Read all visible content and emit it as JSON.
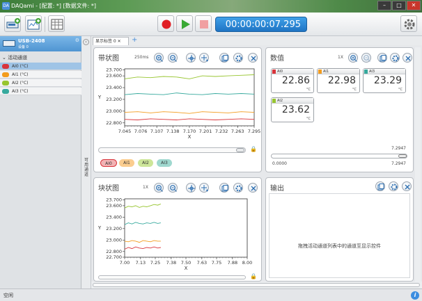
{
  "window": {
    "title": "DAQami - [配置: *] [数据文件: *]",
    "minimize": "–",
    "maximize": "□",
    "close": "✕"
  },
  "toolbar": {
    "timer": "00:00:00:07.295"
  },
  "sidebar": {
    "device_name": "USB-2408",
    "device_sub": "设备 0",
    "group_label": "活动通道",
    "channels": [
      {
        "label": "AI0 (°C)",
        "color": "#d9343b"
      },
      {
        "label": "AI1 (°C)",
        "color": "#f39c1d"
      },
      {
        "label": "AI2 (°C)",
        "color": "#97c52f"
      },
      {
        "label": "AI3 (°C)",
        "color": "#36a99d"
      }
    ],
    "collapsed_tab": "可用通道"
  },
  "tabs": {
    "active": "显示标签 0",
    "close": "✕",
    "add": "+"
  },
  "strip_chart": {
    "title": "带状图",
    "rate": "250ms",
    "pills": [
      "AI0",
      "AI1",
      "AI2",
      "AI3"
    ],
    "xlabel": "X",
    "ylabel": "Y",
    "yticks": [
      "23.700",
      "23.600",
      "23.400",
      "23.200",
      "23.000",
      "22.800"
    ],
    "xticks": [
      "7.045",
      "7.076",
      "7.107",
      "7.138",
      "7.170",
      "7.201",
      "7.232",
      "7.263",
      "7.295"
    ]
  },
  "block_chart": {
    "title": "块状图",
    "rate": "1X",
    "xlabel": "X",
    "ylabel": "Y",
    "yticks": [
      "23.700",
      "23.600",
      "23.400",
      "23.200",
      "23.000",
      "22.800",
      "22.700"
    ],
    "xticks": [
      "7.00",
      "7.13",
      "7.25",
      "7.38",
      "7.50",
      "7.63",
      "7.75",
      "7.88",
      "8.00"
    ]
  },
  "numeric_panel": {
    "title": "数值",
    "rate": "1X",
    "cards": [
      {
        "name": "AI0",
        "value": "22.86",
        "unit": "°C",
        "color": "#d9343b"
      },
      {
        "name": "AI1",
        "value": "22.98",
        "unit": "°C",
        "color": "#f39c1d"
      },
      {
        "name": "AI3",
        "value": "23.29",
        "unit": "°C",
        "color": "#36a99d"
      },
      {
        "name": "AI2",
        "value": "23.62",
        "unit": "°C",
        "color": "#97c52f"
      }
    ],
    "slider_top": "7.2947",
    "slider_min": "0.0000",
    "slider_max": "7.2947"
  },
  "output_panel": {
    "title": "输出",
    "hint": "拖拽活动通道列表中的通道至显示控件"
  },
  "status": {
    "text": "空闲",
    "info": "i"
  },
  "chart_data": [
    {
      "type": "line",
      "title": "带状图",
      "xlabel": "X",
      "ylabel": "Y",
      "ylim": [
        22.75,
        23.72
      ],
      "xlim": [
        7.045,
        7.295
      ],
      "grid": false,
      "x": [
        7.045,
        7.07,
        7.095,
        7.12,
        7.145,
        7.17,
        7.195,
        7.22,
        7.245,
        7.27,
        7.295
      ],
      "series": [
        {
          "name": "AI0",
          "color": "#d9343b",
          "values": [
            22.86,
            22.85,
            22.87,
            22.86,
            22.85,
            22.87,
            22.86,
            22.85,
            22.86,
            22.87,
            22.86
          ]
        },
        {
          "name": "AI1",
          "color": "#f39c1d",
          "values": [
            22.98,
            22.99,
            22.97,
            22.99,
            22.98,
            22.96,
            22.99,
            22.98,
            22.97,
            22.99,
            22.98
          ]
        },
        {
          "name": "AI2",
          "color": "#97c52f",
          "values": [
            23.55,
            23.58,
            23.57,
            23.59,
            23.58,
            23.55,
            23.6,
            23.59,
            23.6,
            23.61,
            23.62
          ]
        },
        {
          "name": "AI3",
          "color": "#36a99d",
          "values": [
            23.28,
            23.3,
            23.29,
            23.28,
            23.31,
            23.29,
            23.28,
            23.3,
            23.29,
            23.3,
            23.29
          ]
        }
      ]
    },
    {
      "type": "line",
      "title": "块状图",
      "xlabel": "X",
      "ylabel": "Y",
      "ylim": [
        22.7,
        23.72
      ],
      "xlim": [
        7.0,
        8.0
      ],
      "grid": false,
      "x": [
        7.0,
        7.03,
        7.06,
        7.09,
        7.12,
        7.15,
        7.18,
        7.21,
        7.24,
        7.27,
        7.295
      ],
      "series": [
        {
          "name": "AI0",
          "color": "#d9343b",
          "values": [
            22.84,
            22.87,
            22.85,
            22.88,
            22.86,
            22.85,
            22.87,
            22.86,
            22.88,
            22.86,
            22.87
          ]
        },
        {
          "name": "AI1",
          "color": "#f39c1d",
          "values": [
            22.98,
            22.97,
            22.99,
            22.98,
            22.96,
            22.99,
            22.98,
            22.97,
            22.99,
            22.98,
            22.98
          ]
        },
        {
          "name": "AI2",
          "color": "#97c52f",
          "values": [
            23.56,
            23.59,
            23.58,
            23.6,
            23.57,
            23.59,
            23.58,
            23.6,
            23.62,
            23.61,
            23.63
          ]
        },
        {
          "name": "AI3",
          "color": "#36a99d",
          "values": [
            23.27,
            23.3,
            23.28,
            23.31,
            23.29,
            23.28,
            23.3,
            23.29,
            23.31,
            23.29,
            23.3
          ]
        }
      ]
    }
  ]
}
